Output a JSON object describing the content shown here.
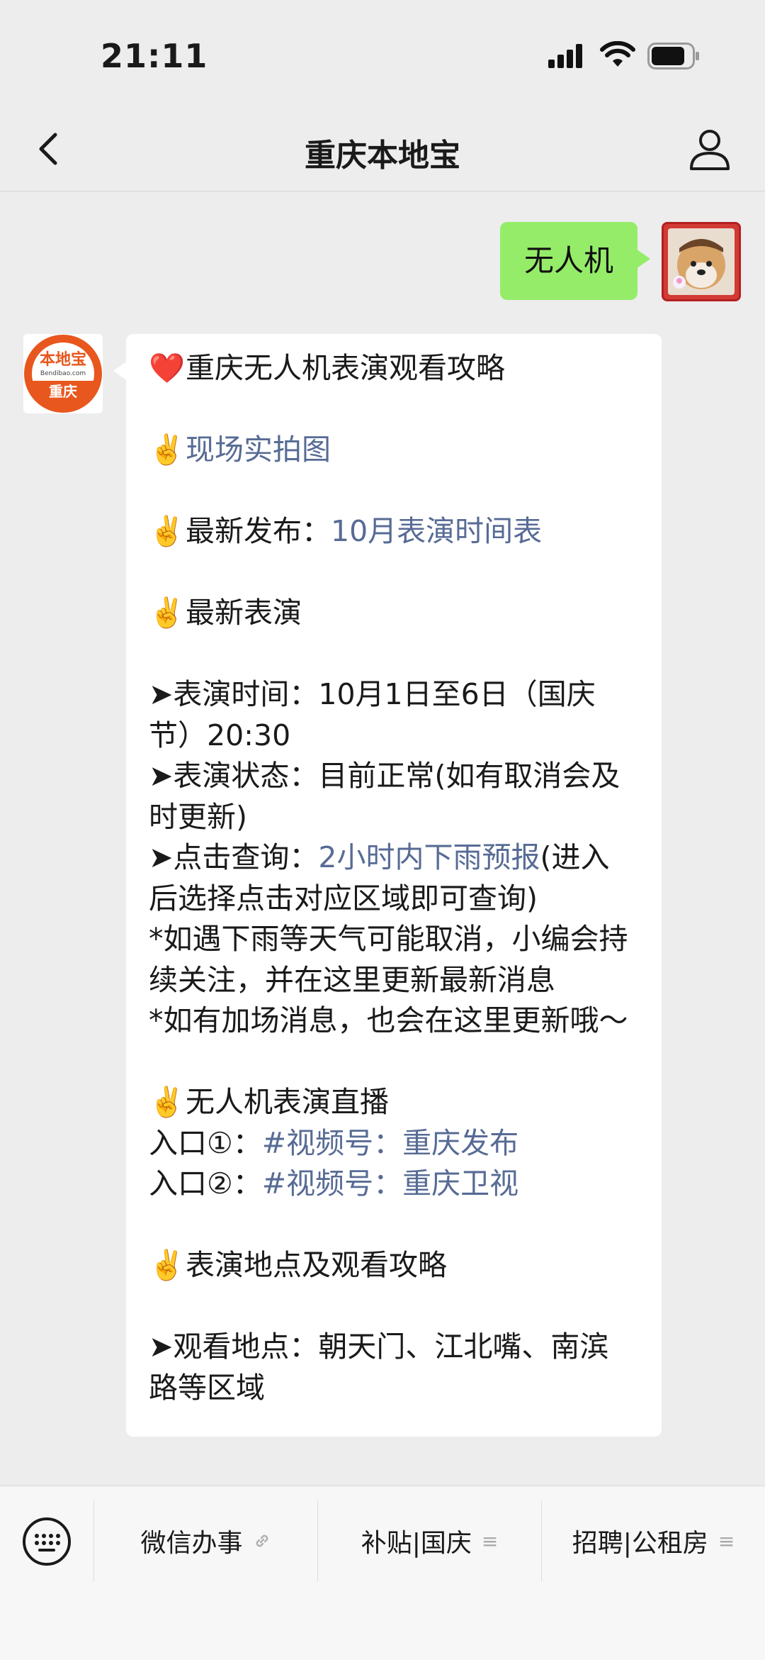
{
  "status_bar": {
    "time": "21:11"
  },
  "header": {
    "title": "重庆本地宝"
  },
  "messages": {
    "outgoing_text": "无人机",
    "bot_logo": {
      "top_text": "本地宝",
      "mid_text": "Bendibao.com",
      "bottom_text": "重庆"
    },
    "article": {
      "l1_heart": "❤️",
      "l1_text": "重庆无人机表演观看攻略",
      "l2_emoji": "✌️",
      "l2_link": "现场实拍图",
      "l3_emoji": "✌️",
      "l3_text": "最新发布：",
      "l3_link": "10月表演时间表",
      "l4_emoji": "✌️",
      "l4_text": "最新表演",
      "l5_text": "➤表演时间：10月1日至6日（国庆节）20:30",
      "l6_text": "➤表演状态：目前正常(如有取消会及时更新)",
      "l7_text": "➤点击查询：",
      "l7_link": "2小时内下雨预报",
      "l7_after": "(进入后选择点击对应区域即可查询)",
      "l8_text": "*如遇下雨等天气可能取消，小编会持续关注，并在这里更新最新消息",
      "l9_text": "*如有加场消息，也会在这里更新哦～",
      "l10_emoji": "✌️",
      "l10_text": "无人机表演直播",
      "l11_text": "入口①：",
      "l11_link": "#视频号：重庆发布",
      "l12_text": "入口②：",
      "l12_link": "#视频号：重庆卫视",
      "l13_emoji": "✌️",
      "l13_text": "表演地点及观看攻略",
      "l14_text": "➤观看地点：朝天门、江北嘴、南滨路等区域"
    }
  },
  "menu": {
    "item1": "微信办事",
    "item2": "补贴|国庆",
    "item3": "招聘|公租房",
    "link_icon": "link-icon",
    "list_icon": "≡"
  },
  "colors": {
    "outgoing_bubble": "#95ec69",
    "link": "#576b95",
    "background": "#ededed",
    "logo_orange": "#e8571e"
  }
}
